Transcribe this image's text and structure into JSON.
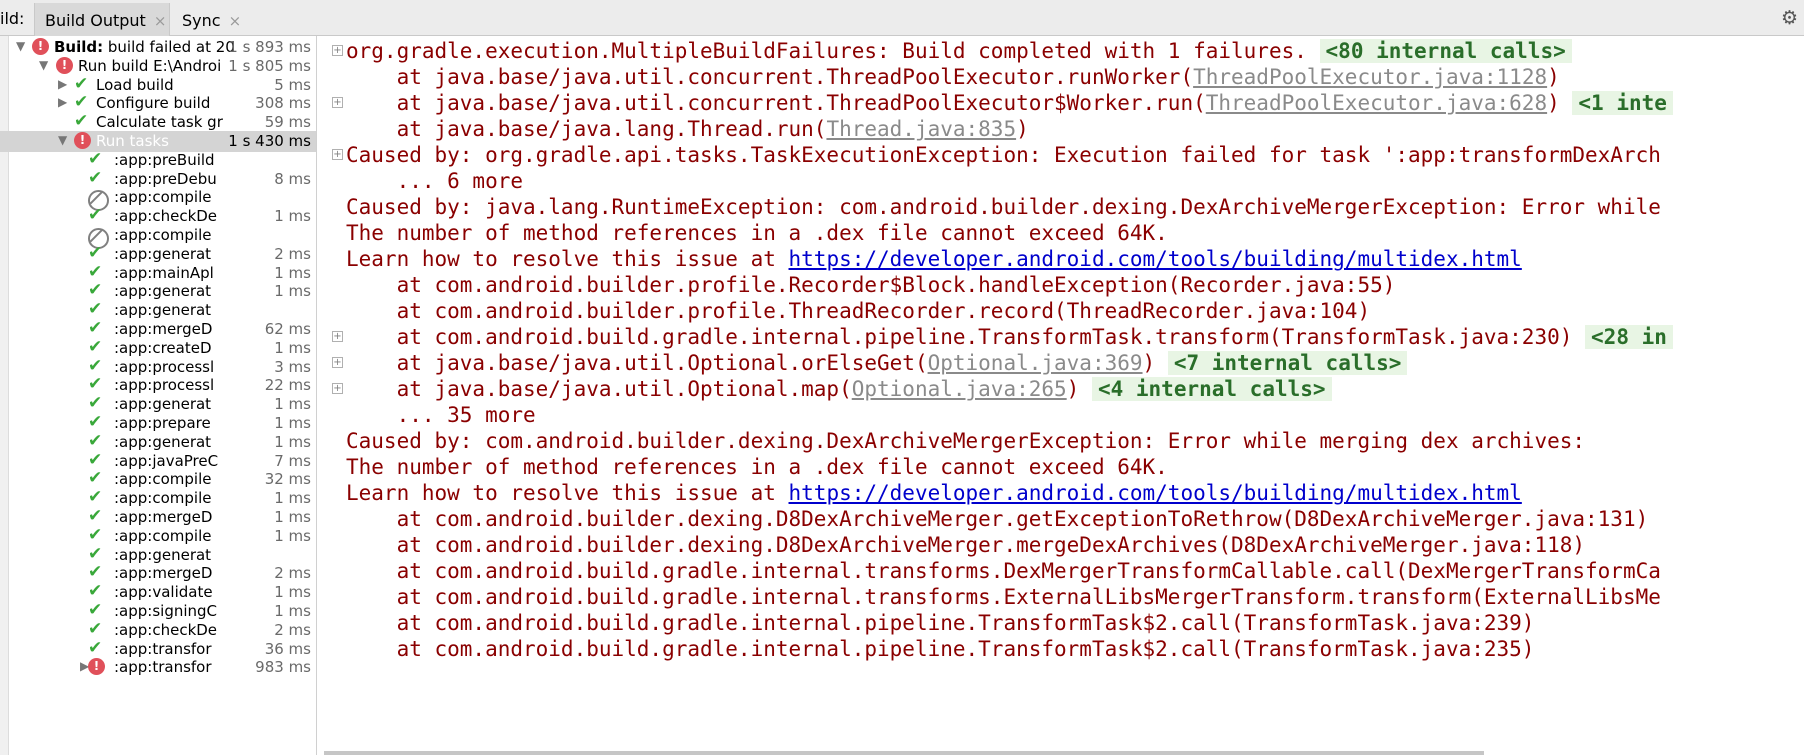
{
  "tabbar": {
    "prefix": "ild:",
    "tabs": [
      {
        "label": "Build Output",
        "close": "×"
      },
      {
        "label": "Sync",
        "close": "×"
      }
    ],
    "gear_icon": "gear-icon"
  },
  "tree": [
    {
      "indent": 0,
      "expander": "down",
      "status": "error",
      "label_bold": "Build:",
      "label": " build failed at 20",
      "time": "1 s 893 ms"
    },
    {
      "indent": 1,
      "expander": "down",
      "status": "error",
      "label": "Run build E:\\Androi",
      "time": "1 s 805 ms"
    },
    {
      "indent": 2,
      "expander": "right",
      "status": "ok",
      "label": "Load build",
      "time": "5 ms"
    },
    {
      "indent": 2,
      "expander": "right",
      "status": "ok",
      "label": "Configure build",
      "time": "308 ms"
    },
    {
      "indent": 2,
      "expander": "",
      "status": "ok",
      "label": "Calculate task gr",
      "time": "59 ms"
    },
    {
      "indent": 2,
      "expander": "down",
      "status": "error",
      "label": "Run tasks",
      "time": "1 s 430 ms",
      "selected": true
    },
    {
      "indent": 3,
      "status": "ok",
      "label": ":app:preBuild",
      "time": ""
    },
    {
      "indent": 3,
      "status": "ok",
      "label": ":app:preDebu",
      "time": "8 ms"
    },
    {
      "indent": 3,
      "status": "skip",
      "label": ":app:compile",
      "time": ""
    },
    {
      "indent": 3,
      "status": "ok",
      "label": ":app:checkDe",
      "time": "1 ms"
    },
    {
      "indent": 3,
      "status": "skip",
      "label": ":app:compile",
      "time": ""
    },
    {
      "indent": 3,
      "status": "ok",
      "label": ":app:generat",
      "time": "2 ms"
    },
    {
      "indent": 3,
      "status": "ok",
      "label": ":app:mainApl",
      "time": "1 ms"
    },
    {
      "indent": 3,
      "status": "ok",
      "label": ":app:generat",
      "time": "1 ms"
    },
    {
      "indent": 3,
      "status": "ok",
      "label": ":app:generat",
      "time": ""
    },
    {
      "indent": 3,
      "status": "ok",
      "label": ":app:mergeD",
      "time": "62 ms"
    },
    {
      "indent": 3,
      "status": "ok",
      "label": ":app:createD",
      "time": "1 ms"
    },
    {
      "indent": 3,
      "status": "ok",
      "label": ":app:processl",
      "time": "3 ms"
    },
    {
      "indent": 3,
      "status": "ok",
      "label": ":app:processl",
      "time": "22 ms"
    },
    {
      "indent": 3,
      "status": "ok",
      "label": ":app:generat",
      "time": "1 ms"
    },
    {
      "indent": 3,
      "status": "ok",
      "label": ":app:prepare",
      "time": "1 ms"
    },
    {
      "indent": 3,
      "status": "ok",
      "label": ":app:generat",
      "time": "1 ms"
    },
    {
      "indent": 3,
      "status": "ok",
      "label": ":app:javaPreC",
      "time": "7 ms"
    },
    {
      "indent": 3,
      "status": "ok",
      "label": ":app:compile",
      "time": "32 ms"
    },
    {
      "indent": 3,
      "status": "ok",
      "label": ":app:compile",
      "time": "1 ms"
    },
    {
      "indent": 3,
      "status": "ok",
      "label": ":app:mergeD",
      "time": "1 ms"
    },
    {
      "indent": 3,
      "status": "ok",
      "label": ":app:compile",
      "time": "1 ms"
    },
    {
      "indent": 3,
      "status": "ok",
      "label": ":app:generat",
      "time": ""
    },
    {
      "indent": 3,
      "status": "ok",
      "label": ":app:mergeD",
      "time": "2 ms"
    },
    {
      "indent": 3,
      "status": "ok",
      "label": ":app:validate",
      "time": "1 ms"
    },
    {
      "indent": 3,
      "status": "ok",
      "label": ":app:signingC",
      "time": "1 ms"
    },
    {
      "indent": 3,
      "status": "ok",
      "label": ":app:checkDe",
      "time": "2 ms"
    },
    {
      "indent": 3,
      "status": "ok",
      "label": ":app:transfor",
      "time": "36 ms"
    },
    {
      "indent": 3,
      "expander": "right",
      "status": "error",
      "label": ":app:transfor",
      "time": "983 ms"
    }
  ],
  "log": [
    {
      "fold": true,
      "parts": [
        {
          "t": "org.gradle.execution.MultipleBuildFailures: Build completed with 1 failures. "
        },
        {
          "t": "<80 internal calls>",
          "k": "chip"
        }
      ]
    },
    {
      "parts": [
        {
          "t": "    at java.base/java.util.concurrent.ThreadPoolExecutor.runWorker("
        },
        {
          "t": "ThreadPoolExecutor.java:1128",
          "k": "gray"
        },
        {
          "t": ")"
        }
      ]
    },
    {
      "fold": true,
      "parts": [
        {
          "t": "    at java.base/java.util.concurrent.ThreadPoolExecutor$Worker.run("
        },
        {
          "t": "ThreadPoolExecutor.java:628",
          "k": "gray"
        },
        {
          "t": ") "
        },
        {
          "t": "<1 inte",
          "k": "chip"
        }
      ]
    },
    {
      "parts": [
        {
          "t": "    at java.base/java.lang.Thread.run("
        },
        {
          "t": "Thread.java:835",
          "k": "gray"
        },
        {
          "t": ")"
        }
      ]
    },
    {
      "fold": true,
      "parts": [
        {
          "t": "Caused by: org.gradle.api.tasks.TaskExecutionException: Execution failed for task ':app:transformDexArch"
        }
      ]
    },
    {
      "parts": [
        {
          "t": "    ... 6 more"
        }
      ]
    },
    {
      "parts": [
        {
          "t": "Caused by: java.lang.RuntimeException: com.android.builder.dexing.DexArchiveMergerException: Error while"
        }
      ]
    },
    {
      "parts": [
        {
          "t": "The number of method references in a .dex file cannot exceed 64K."
        }
      ]
    },
    {
      "parts": [
        {
          "t": "Learn how to resolve this issue at "
        },
        {
          "t": "https://developer.android.com/tools/building/multidex.html",
          "k": "link"
        }
      ]
    },
    {
      "parts": [
        {
          "t": "    at com.android.builder.profile.Recorder$Block.handleException(Recorder.java:55)"
        }
      ]
    },
    {
      "parts": [
        {
          "t": "    at com.android.builder.profile.ThreadRecorder.record(ThreadRecorder.java:104)"
        }
      ]
    },
    {
      "fold": true,
      "parts": [
        {
          "t": "    at com.android.build.gradle.internal.pipeline.TransformTask.transform(TransformTask.java:230) "
        },
        {
          "t": "<28 in",
          "k": "chip"
        }
      ]
    },
    {
      "fold": true,
      "parts": [
        {
          "t": "    at java.base/java.util.Optional.orElseGet("
        },
        {
          "t": "Optional.java:369",
          "k": "gray"
        },
        {
          "t": ") "
        },
        {
          "t": "<7 internal calls>",
          "k": "chip"
        }
      ]
    },
    {
      "fold": true,
      "parts": [
        {
          "t": "    at java.base/java.util.Optional.map("
        },
        {
          "t": "Optional.java:265",
          "k": "gray"
        },
        {
          "t": ") "
        },
        {
          "t": "<4 internal calls>",
          "k": "chip"
        }
      ]
    },
    {
      "parts": [
        {
          "t": "    ... 35 more"
        }
      ]
    },
    {
      "parts": [
        {
          "t": "Caused by: com.android.builder.dexing.DexArchiveMergerException: Error while merging dex archives:"
        }
      ]
    },
    {
      "parts": [
        {
          "t": "The number of method references in a .dex file cannot exceed 64K."
        }
      ]
    },
    {
      "parts": [
        {
          "t": "Learn how to resolve this issue at "
        },
        {
          "t": "https://developer.android.com/tools/building/multidex.html",
          "k": "link"
        }
      ]
    },
    {
      "parts": [
        {
          "t": "    at com.android.builder.dexing.D8DexArchiveMerger.getExceptionToRethrow(D8DexArchiveMerger.java:131)"
        }
      ]
    },
    {
      "parts": [
        {
          "t": "    at com.android.builder.dexing.D8DexArchiveMerger.mergeDexArchives(D8DexArchiveMerger.java:118)"
        }
      ]
    },
    {
      "parts": [
        {
          "t": "    at com.android.build.gradle.internal.transforms.DexMergerTransformCallable.call(DexMergerTransformCa"
        }
      ]
    },
    {
      "parts": [
        {
          "t": "    at com.android.build.gradle.internal.transforms.ExternalLibsMergerTransform.transform(ExternalLibsMe"
        }
      ]
    },
    {
      "parts": [
        {
          "t": "    at com.android.build.gradle.internal.pipeline.TransformTask$2.call(TransformTask.java:239)"
        }
      ]
    },
    {
      "parts": [
        {
          "t": "    at com.android.build.gradle.internal.pipeline.TransformTask$2.call(TransformTask.java:235)"
        }
      ]
    }
  ],
  "colors": {
    "error": "#e0505a",
    "ok": "#39a83a",
    "log_text": "#8a0000",
    "link": "#0000cc",
    "chip_bg": "#e8f5e4"
  }
}
